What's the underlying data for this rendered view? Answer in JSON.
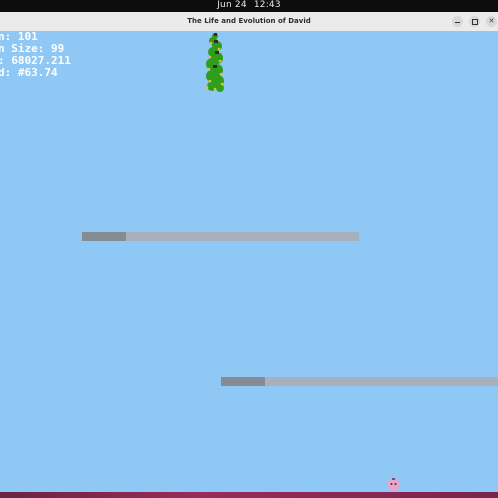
{
  "system_bar": {
    "date": "Jun 24",
    "time": "12:43"
  },
  "window": {
    "title": "The Life and Evolution of David"
  },
  "hud": {
    "line1": "n: 101",
    "line2": "n Size: 99",
    "line3": ": 68027.211",
    "line4": "d: #63.74"
  },
  "colors": {
    "sky": "#8fc7f5",
    "platform": "#a8b1bb",
    "platform_progress": "#858c93",
    "bottom_strip": "#9a2b5a"
  },
  "icons": {
    "minimize": "minimize-icon",
    "maximize": "maximize-icon",
    "close": "close-icon"
  },
  "platforms": [
    {
      "name": "platform-upper",
      "progress": 0.16
    },
    {
      "name": "platform-lower",
      "progress": 0.16
    }
  ]
}
